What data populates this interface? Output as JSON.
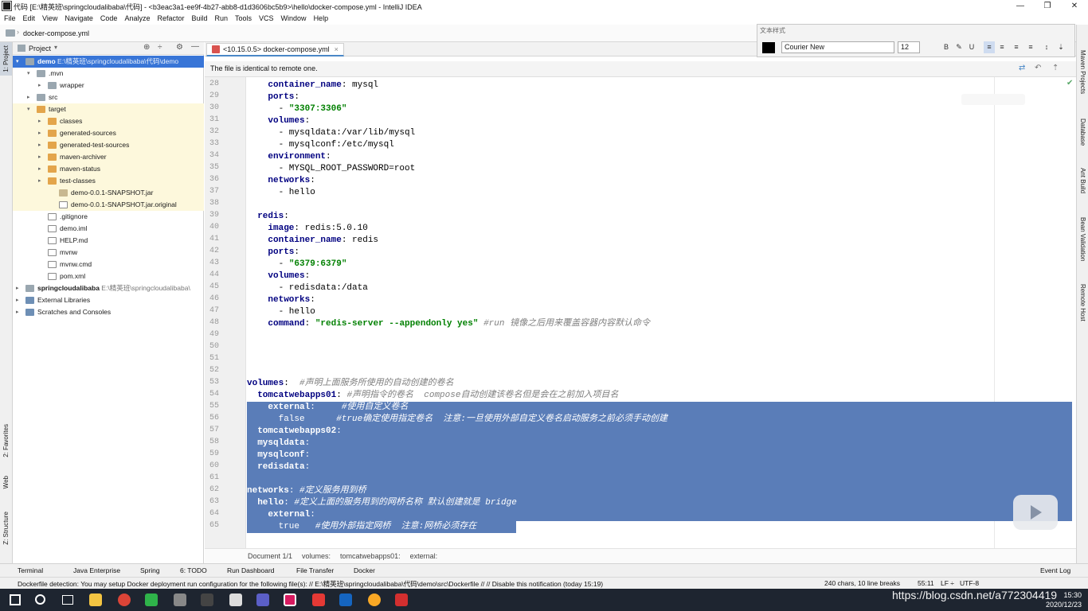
{
  "window": {
    "title": "代码 [E:\\精英班\\springcloudalibaba\\代码] - <b3eac3a1-ee9f-4b27-abb8-d1d3606bc5b9>\\hello\\docker-compose.yml - IntelliJ IDEA",
    "minimize": "—",
    "maximize": "❐",
    "close": "✕"
  },
  "menu": [
    "File",
    "Edit",
    "View",
    "Navigate",
    "Code",
    "Analyze",
    "Refactor",
    "Build",
    "Run",
    "Tools",
    "VCS",
    "Window",
    "Help"
  ],
  "navbar": {
    "crumb": "docker-compose.yml"
  },
  "left_strip": {
    "project": "1: Project",
    "favorites": "2: Favorites",
    "web": "Web",
    "structure": "Z: Structure"
  },
  "project_panel": {
    "title": "Project",
    "tree": [
      {
        "label": "demo",
        "path": "E:\\精英班\\springcloudalibaba\\代码\\demo",
        "icon": "module-folder-icon",
        "depth": 0,
        "arrow": "▾",
        "selected": true
      },
      {
        "label": ".mvn",
        "icon": "folder-icon",
        "depth": 1,
        "arrow": "▾"
      },
      {
        "label": "wrapper",
        "icon": "folder-icon",
        "depth": 2,
        "arrow": "▸"
      },
      {
        "label": "src",
        "icon": "folder-icon",
        "depth": 1,
        "arrow": "▸"
      },
      {
        "label": "target",
        "icon": "excluded-folder-icon",
        "depth": 1,
        "arrow": "▾",
        "highlight": true
      },
      {
        "label": "classes",
        "icon": "excluded-folder-icon",
        "depth": 2,
        "arrow": "▸",
        "highlight": true
      },
      {
        "label": "generated-sources",
        "icon": "excluded-folder-icon",
        "depth": 2,
        "arrow": "▸",
        "highlight": true
      },
      {
        "label": "generated-test-sources",
        "icon": "excluded-folder-icon",
        "depth": 2,
        "arrow": "▸",
        "highlight": true
      },
      {
        "label": "maven-archiver",
        "icon": "excluded-folder-icon",
        "depth": 2,
        "arrow": "▸",
        "highlight": true
      },
      {
        "label": "maven-status",
        "icon": "excluded-folder-icon",
        "depth": 2,
        "arrow": "▸",
        "highlight": true
      },
      {
        "label": "test-classes",
        "icon": "excluded-folder-icon",
        "depth": 2,
        "arrow": "▸",
        "highlight": true
      },
      {
        "label": "demo-0.0.1-SNAPSHOT.jar",
        "icon": "jar-icon",
        "depth": 3,
        "arrow": "",
        "highlight": true
      },
      {
        "label": "demo-0.0.1-SNAPSHOT.jar.original",
        "icon": "file-icon",
        "depth": 3,
        "arrow": "",
        "highlight": true
      },
      {
        "label": ".gitignore",
        "icon": "file-icon",
        "depth": 2,
        "arrow": ""
      },
      {
        "label": "demo.iml",
        "icon": "file-icon",
        "depth": 2,
        "arrow": ""
      },
      {
        "label": "HELP.md",
        "icon": "markdown-icon",
        "depth": 2,
        "arrow": ""
      },
      {
        "label": "mvnw",
        "icon": "file-icon",
        "depth": 2,
        "arrow": ""
      },
      {
        "label": "mvnw.cmd",
        "icon": "file-icon",
        "depth": 2,
        "arrow": ""
      },
      {
        "label": "pom.xml",
        "icon": "maven-icon",
        "depth": 2,
        "arrow": ""
      },
      {
        "label": "springcloudalibaba",
        "path": "E:\\精英班\\springcloudalibaba\\",
        "icon": "module-folder-icon",
        "depth": 0,
        "arrow": "▸"
      },
      {
        "label": "External Libraries",
        "icon": "library-icon",
        "depth": 0,
        "arrow": "▸"
      },
      {
        "label": "Scratches and Consoles",
        "icon": "scratch-icon",
        "depth": 0,
        "arrow": "▸"
      }
    ]
  },
  "editor_tab": {
    "label": "<10.15.0.5> docker-compose.yml",
    "close": "×"
  },
  "notice": {
    "text": "The file is identical to remote one."
  },
  "code": [
    {
      "n": "28",
      "t": [
        [
          "    ",
          "p"
        ],
        [
          "container_name",
          "k"
        ],
        [
          ": mysql",
          "p"
        ]
      ]
    },
    {
      "n": "29",
      "t": [
        [
          "    ",
          "p"
        ],
        [
          "ports",
          "k"
        ],
        [
          ":",
          "p"
        ]
      ]
    },
    {
      "n": "30",
      "t": [
        [
          "      - ",
          "p"
        ],
        [
          "\"3307:3306\"",
          "s"
        ]
      ]
    },
    {
      "n": "31",
      "t": [
        [
          "    ",
          "p"
        ],
        [
          "volumes",
          "k"
        ],
        [
          ":",
          "p"
        ]
      ]
    },
    {
      "n": "32",
      "t": [
        [
          "      - mysqldata:/var/lib/mysql",
          "p"
        ]
      ]
    },
    {
      "n": "33",
      "t": [
        [
          "      - mysqlconf:/etc/mysql",
          "p"
        ]
      ]
    },
    {
      "n": "34",
      "t": [
        [
          "    ",
          "p"
        ],
        [
          "environment",
          "k"
        ],
        [
          ":",
          "p"
        ]
      ]
    },
    {
      "n": "35",
      "t": [
        [
          "      - MYSQL_ROOT_PASSWORD=root",
          "p"
        ]
      ]
    },
    {
      "n": "36",
      "t": [
        [
          "    ",
          "p"
        ],
        [
          "networks",
          "k"
        ],
        [
          ":",
          "p"
        ]
      ]
    },
    {
      "n": "37",
      "t": [
        [
          "      - hello",
          "p"
        ]
      ]
    },
    {
      "n": "38",
      "t": [
        [
          "",
          "p"
        ]
      ]
    },
    {
      "n": "39",
      "t": [
        [
          "  ",
          "p"
        ],
        [
          "redis",
          "k"
        ],
        [
          ":",
          "p"
        ]
      ]
    },
    {
      "n": "40",
      "t": [
        [
          "    ",
          "p"
        ],
        [
          "image",
          "k"
        ],
        [
          ": redis:5.0.10",
          "p"
        ]
      ]
    },
    {
      "n": "41",
      "t": [
        [
          "    ",
          "p"
        ],
        [
          "container_name",
          "k"
        ],
        [
          ": redis",
          "p"
        ]
      ]
    },
    {
      "n": "42",
      "t": [
        [
          "    ",
          "p"
        ],
        [
          "ports",
          "k"
        ],
        [
          ":",
          "p"
        ]
      ]
    },
    {
      "n": "43",
      "t": [
        [
          "      - ",
          "p"
        ],
        [
          "\"6379:6379\"",
          "s"
        ]
      ]
    },
    {
      "n": "44",
      "t": [
        [
          "    ",
          "p"
        ],
        [
          "volumes",
          "k"
        ],
        [
          ":",
          "p"
        ]
      ]
    },
    {
      "n": "45",
      "t": [
        [
          "      - redisdata:/data",
          "p"
        ]
      ]
    },
    {
      "n": "46",
      "t": [
        [
          "    ",
          "p"
        ],
        [
          "networks",
          "k"
        ],
        [
          ":",
          "p"
        ]
      ]
    },
    {
      "n": "47",
      "t": [
        [
          "      - hello",
          "p"
        ]
      ]
    },
    {
      "n": "48",
      "t": [
        [
          "    ",
          "p"
        ],
        [
          "command",
          "k"
        ],
        [
          ": ",
          "p"
        ],
        [
          "\"redis-server --appendonly yes\"",
          "s"
        ],
        [
          " #run 镜像之后用来覆盖容器内容默认命令",
          "c"
        ]
      ]
    },
    {
      "n": "49",
      "t": [
        [
          "",
          "p"
        ]
      ]
    },
    {
      "n": "50",
      "t": [
        [
          "",
          "p"
        ]
      ]
    },
    {
      "n": "51",
      "t": [
        [
          "",
          "p"
        ]
      ]
    },
    {
      "n": "52",
      "t": [
        [
          "",
          "p"
        ]
      ]
    },
    {
      "n": "53",
      "t": [
        [
          "volumes",
          "k"
        ],
        [
          ":  ",
          "p"
        ],
        [
          "#声明上面服务所使用的自动创建的卷名",
          "c"
        ]
      ]
    },
    {
      "n": "54",
      "t": [
        [
          "  ",
          "p"
        ],
        [
          "tomcatwebapps01",
          "k"
        ],
        [
          ": ",
          "p"
        ],
        [
          "#声明指令的卷名  compose自动创建该卷名但是会在之前加入项目名",
          "c"
        ]
      ]
    },
    {
      "n": "55",
      "t": [
        [
          "    ",
          "p"
        ],
        [
          "external",
          "k"
        ],
        [
          ":     ",
          "p"
        ],
        [
          "#使用自定义卷名",
          "c"
        ]
      ]
    },
    {
      "n": "56",
      "t": [
        [
          "      false      ",
          "p"
        ],
        [
          "#true确定使用指定卷名  注意:一旦使用外部自定义卷名启动服务之前必须手动创建",
          "c"
        ]
      ]
    },
    {
      "n": "57",
      "t": [
        [
          "  ",
          "p"
        ],
        [
          "tomcatwebapps02",
          "k"
        ],
        [
          ":",
          "p"
        ]
      ]
    },
    {
      "n": "58",
      "t": [
        [
          "  ",
          "p"
        ],
        [
          "mysqldata",
          "k"
        ],
        [
          ":",
          "p"
        ]
      ]
    },
    {
      "n": "59",
      "t": [
        [
          "  ",
          "p"
        ],
        [
          "mysqlconf",
          "k"
        ],
        [
          ":",
          "p"
        ]
      ]
    },
    {
      "n": "60",
      "t": [
        [
          "  ",
          "p"
        ],
        [
          "redisdata",
          "k"
        ],
        [
          ":",
          "p"
        ]
      ]
    },
    {
      "n": "61",
      "t": [
        [
          "",
          "p"
        ]
      ]
    },
    {
      "n": "62",
      "t": [
        [
          "networks",
          "k"
        ],
        [
          ": ",
          "p"
        ],
        [
          "#定义服务用到桥",
          "c"
        ]
      ]
    },
    {
      "n": "63",
      "t": [
        [
          "  ",
          "p"
        ],
        [
          "hello",
          "k"
        ],
        [
          ": ",
          "p"
        ],
        [
          "#定义上面的服务用到的网桥名称 默认创建就是 bridge",
          "c"
        ]
      ]
    },
    {
      "n": "64",
      "t": [
        [
          "    ",
          "p"
        ],
        [
          "external",
          "k"
        ],
        [
          ":",
          "p"
        ]
      ]
    },
    {
      "n": "65",
      "t": [
        [
          "      true   ",
          "p"
        ],
        [
          "#使用外部指定网桥  注意:网桥必须存在",
          "c"
        ]
      ]
    }
  ],
  "editor_breadcrumb": [
    "Document 1/1",
    "volumes:",
    "tomcatwebapps01:",
    "external:"
  ],
  "right_strip": [
    "Maven Projects",
    "Database",
    "Ant Build",
    "Bean Validation",
    "Remote Host"
  ],
  "tool_windows": [
    "Terminal",
    "Java Enterprise",
    "Spring",
    "6: TODO",
    "Run Dashboard",
    "File Transfer",
    "Docker",
    "Event Log"
  ],
  "status": {
    "message": "Dockerfile detection: You may setup Docker deployment run configuration for the following file(s): // E:\\精英班\\springcloudalibaba\\代码\\demo\\src\\Dockerfile // // Disable this notification (today 15:19)",
    "chars": "240 chars, 10 line breaks",
    "position": "55:11",
    "line_sep": "LF ÷",
    "encoding": "UTF-8"
  },
  "text_style": {
    "caption": "文本样式",
    "font": "Courier New",
    "size": "12",
    "color": "#000000"
  },
  "taskbar": {
    "date": "2020/12/23",
    "time": "15:30"
  },
  "watermark": "https://blog.csdn.net/a772304419",
  "colors": {
    "selection": "#5a7db8",
    "keyword": "#000080",
    "string": "#008000",
    "comment": "#808080",
    "tree_selected": "#3875d7",
    "excluded_bg": "#fdf8dc"
  }
}
